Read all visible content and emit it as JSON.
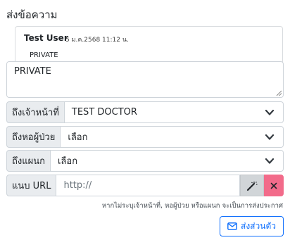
{
  "page": {
    "title": "ส่งข้อความ"
  },
  "message": {
    "author": "Test User",
    "timestamp": "5 ม.ค.2568 11:12 น.",
    "content": "PRIVATE"
  },
  "compose": {
    "text": "PRIVATE"
  },
  "fields": {
    "staff": {
      "label": "ถึงเจ้าหน้าที่",
      "value": "TEST DOCTOR"
    },
    "ward": {
      "label": "ถึงหอผู้ป่วย",
      "value": "เลือก"
    },
    "department": {
      "label": "ถึงแผนก",
      "value": "เลือก"
    },
    "url": {
      "label": "แนบ URL",
      "placeholder": "http://"
    }
  },
  "hint": "หากไม่ระบุเจ้าหน้าที่, หอผู้ป่วย หรือแผนก จะเป็นการส่งประกาศ",
  "send_button": {
    "label": "ส่งส่วนตัว"
  },
  "icons": {
    "dropdown": "chevron-down-icon",
    "magic": "magic-wand-icon",
    "clear": "close-icon",
    "send": "envelope-icon"
  },
  "colors": {
    "primary": "#0d6efd",
    "danger": "#f26b8a",
    "addon": "#e9ecef",
    "border": "#ced4da"
  }
}
